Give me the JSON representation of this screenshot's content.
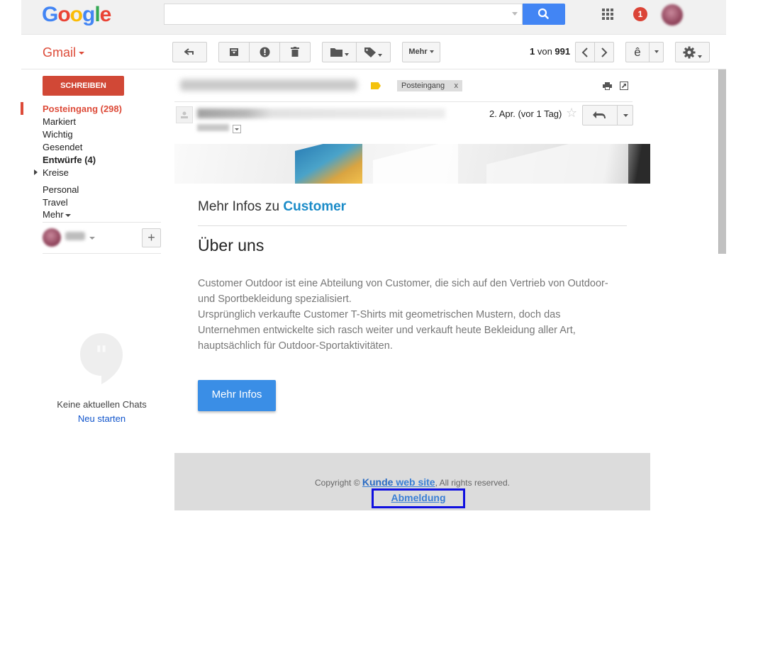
{
  "brand": {
    "logo_text": "Google",
    "logo_letters": [
      "G",
      "o",
      "o",
      "g",
      "l",
      "e"
    ],
    "logo_colors": [
      "#4285f4",
      "#ea4335",
      "#fbbc05",
      "#4285f4",
      "#34a853",
      "#ea4335"
    ]
  },
  "header": {
    "search_placeholder": "",
    "notification_count": "1",
    "icons": [
      "search-icon",
      "apps-grid-icon",
      "notifications-icon",
      "account-avatar"
    ]
  },
  "toolbar": {
    "app_label": "Gmail",
    "more_label": "Mehr",
    "pager_current": "1",
    "pager_of": " von ",
    "pager_total": "991",
    "input_tool_label": "ê",
    "icons": [
      "back-icon",
      "archive-icon",
      "spam-icon",
      "delete-icon",
      "move-to-folder-icon",
      "labels-icon",
      "previous-icon",
      "next-icon",
      "settings-icon"
    ]
  },
  "sidebar": {
    "compose_label": "SCHREIBEN",
    "items": [
      {
        "label": "Posteingang (298)",
        "active": true
      },
      {
        "label": "Markiert"
      },
      {
        "label": "Wichtig"
      },
      {
        "label": "Gesendet"
      },
      {
        "label": "Entwürfe (4)",
        "bold": true
      },
      {
        "label": "Kreise"
      },
      {
        "label": "Personal"
      },
      {
        "label": "Travel"
      },
      {
        "label": "Mehr"
      }
    ],
    "hangouts": {
      "empty_text": "Keine aktuellen Chats",
      "start_link": "Neu starten",
      "add_label": "+"
    }
  },
  "message": {
    "inbox_chip": "Posteingang",
    "chip_close": "x",
    "date": "2. Apr. (vor 1 Tag)",
    "accent_color": "#1a8bc8"
  },
  "email": {
    "more_info_prefix": "Mehr Infos zu ",
    "brand_name": "Customer",
    "heading": "Über uns",
    "paragraph_1": "Customer Outdoor ist eine Abteilung von Customer, die sich auf den Vertrieb von Outdoor- und Sportbekleidung spezialisiert.",
    "paragraph_2": "Ursprünglich verkaufte Customer T-Shirts mit geometrischen Mustern, doch das Unternehmen entwickelte sich rasch weiter und verkauft heute Bekleidung aller Art, hauptsächlich für Outdoor-Sportaktivitäten.",
    "cta_label": "Mehr Infos",
    "copyright_prefix": "Copyright © ",
    "site_link_bold": "Kunde",
    "site_link_rest": " web site",
    "copyright_suffix": ", All rights reserved.",
    "unsubscribe": "Abmeldung"
  }
}
